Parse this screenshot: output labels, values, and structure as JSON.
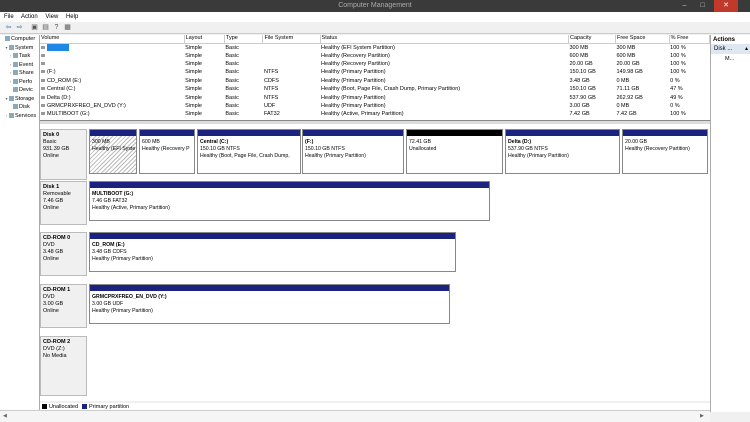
{
  "window": {
    "title": "Computer Management",
    "min": "–",
    "max": "□",
    "close": "✕"
  },
  "menu": [
    "File",
    "Action",
    "View",
    "Help"
  ],
  "toolbar": {
    "icons": [
      "back-arrow-icon",
      "forward-arrow-icon",
      "up-folder-icon",
      "properties-icon",
      "help-icon",
      "refresh-icon"
    ],
    "glyphs": [
      "⇦",
      "⇨",
      "▣",
      "▤",
      "?",
      "▦"
    ]
  },
  "tree": [
    {
      "label": "Computer",
      "tw": "",
      "indent": 0
    },
    {
      "label": "System",
      "tw": "▾",
      "indent": 1
    },
    {
      "label": "Task",
      "tw": "›",
      "indent": 2
    },
    {
      "label": "Event",
      "tw": "›",
      "indent": 2
    },
    {
      "label": "Share",
      "tw": "›",
      "indent": 2
    },
    {
      "label": "Perfo",
      "tw": "›",
      "indent": 2
    },
    {
      "label": "Devic",
      "tw": "",
      "indent": 2
    },
    {
      "label": "Storage",
      "tw": "▾",
      "indent": 1
    },
    {
      "label": "Disk",
      "tw": "",
      "indent": 2
    },
    {
      "label": "Services",
      "tw": "›",
      "indent": 1
    }
  ],
  "volumes": {
    "headers": [
      "Volume",
      "Layout",
      "Type",
      "File System",
      "Status",
      "Capacity",
      "Free Space",
      "% Free"
    ],
    "rows": [
      [
        "",
        "Simple",
        "Basic",
        "",
        "Healthy (EFI System Partition)",
        "300 MB",
        "300 MB",
        "100 %"
      ],
      [
        "",
        "Simple",
        "Basic",
        "",
        "Healthy (Recovery Partition)",
        "600 MB",
        "600 MB",
        "100 %"
      ],
      [
        "",
        "Simple",
        "Basic",
        "",
        "Healthy (Recovery Partition)",
        "20.00 GB",
        "20.00 GB",
        "100 %"
      ],
      [
        "(F:)",
        "Simple",
        "Basic",
        "NTFS",
        "Healthy (Primary Partition)",
        "150.10 GB",
        "149.98 GB",
        "100 %"
      ],
      [
        "CD_ROM (E:)",
        "Simple",
        "Basic",
        "CDFS",
        "Healthy (Primary Partition)",
        "3.48 GB",
        "0 MB",
        "0 %"
      ],
      [
        "Central (C:)",
        "Simple",
        "Basic",
        "NTFS",
        "Healthy (Boot, Page File, Crash Dump, Primary Partition)",
        "150.10 GB",
        "71.11 GB",
        "47 %"
      ],
      [
        "Delta (D:)",
        "Simple",
        "Basic",
        "NTFS",
        "Healthy (Primary Partition)",
        "537.90 GB",
        "262.92 GB",
        "49 %"
      ],
      [
        "GRMCPRXFREO_EN_DVD (Y:)",
        "Simple",
        "Basic",
        "UDF",
        "Healthy (Primary Partition)",
        "3.00 GB",
        "0 MB",
        "0 %"
      ],
      [
        "MULTIBOOT (G:)",
        "Simple",
        "Basic",
        "FAT32",
        "Healthy (Active, Primary Partition)",
        "7.42 GB",
        "7.42 GB",
        "100 %"
      ]
    ]
  },
  "disks": [
    {
      "name": "Disk 0",
      "lines": [
        "Basic",
        "931.39 GB",
        "Online"
      ],
      "parts": [
        {
          "name": "",
          "l1": "300 MB",
          "l2": "Healthy (EFI Syste",
          "kind": "hatch"
        },
        {
          "name": "",
          "l1": "600 MB",
          "l2": "Healthy (Recovery P",
          "kind": "normal"
        },
        {
          "name": "Central  (C:)",
          "l1": "150.10 GB NTFS",
          "l2": "Healthy (Boot, Page File, Crash Dump,",
          "kind": "normal"
        },
        {
          "name": "(F:)",
          "l1": "150.10 GB NTFS",
          "l2": "Healthy (Primary Partition)",
          "kind": "normal"
        },
        {
          "name": "",
          "l1": "72.41 GB",
          "l2": "Unallocated",
          "kind": "unalloc"
        },
        {
          "name": "Delta  (D:)",
          "l1": "537.90 GB NTFS",
          "l2": "Healthy (Primary Partition)",
          "kind": "normal"
        },
        {
          "name": "",
          "l1": "20.00 GB",
          "l2": "Healthy (Recovery Partition)",
          "kind": "normal"
        }
      ]
    },
    {
      "name": "Disk 1",
      "lines": [
        "Removable",
        "7.46 GB",
        "Online"
      ],
      "parts": [
        {
          "name": "MULTIBOOT  (G:)",
          "l1": "7.46 GB FAT32",
          "l2": "Healthy (Active, Primary Partition)",
          "kind": "normal"
        }
      ]
    },
    {
      "name": "CD-ROM 0",
      "lines": [
        "DVD",
        "3.48 GB",
        "Online"
      ],
      "parts": [
        {
          "name": "CD_ROM  (E:)",
          "l1": "3.48 GB CDFS",
          "l2": "Healthy (Primary Partition)",
          "kind": "normal"
        }
      ]
    },
    {
      "name": "CD-ROM 1",
      "lines": [
        "DVD",
        "3.00 GB",
        "Online"
      ],
      "parts": [
        {
          "name": "GRMCPRXFREO_EN_DVD  (Y:)",
          "l1": "3.00 GB UDF",
          "l2": "Healthy (Primary Partition)",
          "kind": "normal"
        }
      ]
    },
    {
      "name": "CD-ROM 2",
      "lines": [
        "DVD (Z:)",
        "",
        "No Media"
      ],
      "parts": []
    }
  ],
  "legend": [
    {
      "label": "Unallocated",
      "color": "#000000"
    },
    {
      "label": "Primary partition",
      "color": "#1a237e"
    }
  ],
  "actions": {
    "header": "Actions",
    "selected": "Disk ...",
    "more": "M..."
  }
}
